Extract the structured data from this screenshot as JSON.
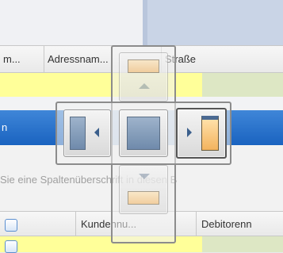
{
  "grid_top": {
    "headers": [
      "m...",
      "Adressnam...",
      "Straße"
    ]
  },
  "group_panel": {
    "hint": "Sie eine Spaltenüberschrift in diesen B"
  },
  "blue_bar": {
    "label": "n"
  },
  "grid_bottom": {
    "headers": [
      "Kundennu...",
      "Debitorenn"
    ]
  },
  "colors": {
    "selected_row": "#1a63c0",
    "highlight_row": "#ffff99",
    "dock_window": "#f3b35e"
  },
  "icons": [
    "dock-top-icon",
    "dock-left-icon",
    "dock-center-icon",
    "dock-right-icon",
    "dock-bottom-icon",
    "checkbox-icon"
  ]
}
